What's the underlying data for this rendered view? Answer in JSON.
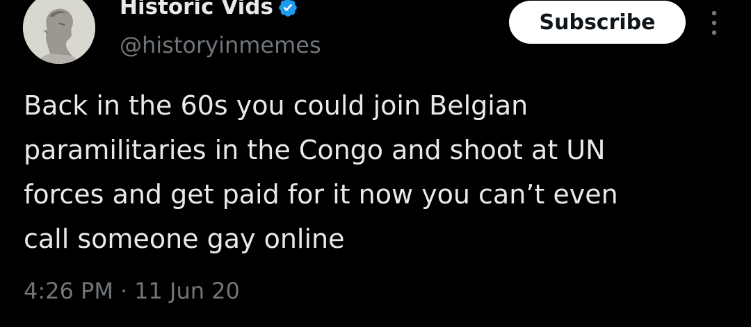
{
  "author": {
    "display_name": "Historic Vids",
    "handle": "@historyinmemes",
    "verified": true,
    "avatar_icon": "classical-bust-avatar-icon",
    "verified_color": "#1d9bf0"
  },
  "actions": {
    "subscribe_label": "Subscribe",
    "more_icon": "more-vertical-icon"
  },
  "tweet": {
    "lines": [
      "Back in the 60s you could join Belgian",
      "paramilitaries in the Congo and shoot at UN",
      "forces and get paid for it now you can’t even",
      "call someone gay online"
    ],
    "time": "4:26 PM",
    "separator": "·",
    "date": "11 Jun 20"
  },
  "colors": {
    "background": "#000000",
    "text_primary": "#e7e9ea",
    "text_secondary": "#71767b",
    "button_bg": "#ffffff",
    "button_text": "#0f1419"
  }
}
